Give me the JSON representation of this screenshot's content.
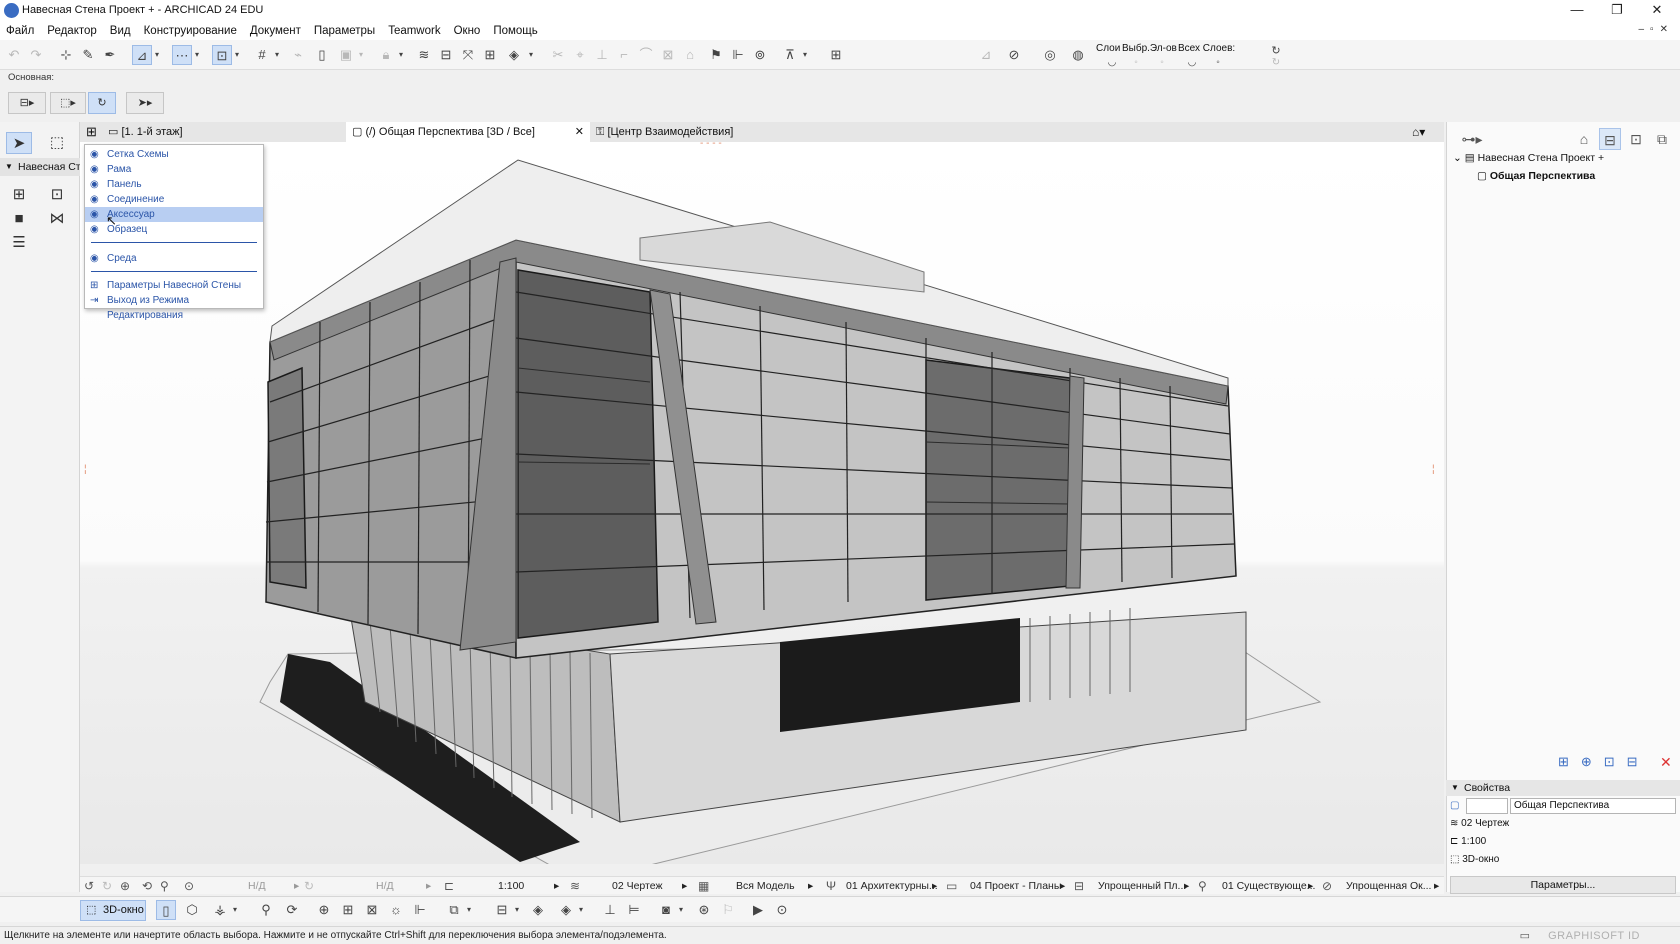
{
  "window": {
    "title": "Навесная Стена Проект + - ARCHICAD 24 EDU",
    "controls": [
      "—",
      "❐",
      "✕"
    ]
  },
  "menu": [
    "Файл",
    "Редактор",
    "Вид",
    "Конструирование",
    "Документ",
    "Параметры",
    "Teamwork",
    "Окно",
    "Помощь"
  ],
  "toolbar": {
    "layers_label": "Слои",
    "selected_elements_label": "Выбр.Эл-ов",
    "all_layers_label": "Всех Слоев:"
  },
  "basic_label": "Основная:",
  "tabs": [
    {
      "label": "[1. 1-й этаж]"
    },
    {
      "label": "(/) Общая Перспектива [3D / Все]"
    },
    {
      "label": "[Центр Взаимодействия]"
    }
  ],
  "toolbox": {
    "group": "Навесная Стена"
  },
  "context_menu": {
    "items": [
      {
        "label": "Сетка Схемы",
        "icon": "eye-icon"
      },
      {
        "label": "Рама",
        "icon": "eye-icon"
      },
      {
        "label": "Панель",
        "icon": "eye-icon"
      },
      {
        "label": "Соединение",
        "icon": "eye-icon"
      },
      {
        "label": "Аксессуар",
        "icon": "eye-icon",
        "highlighted": true
      },
      {
        "label": "Образец",
        "icon": "eye-icon"
      },
      {
        "label": "Среда",
        "icon": "eye-icon"
      },
      {
        "label": "Параметры Навесной Стены",
        "icon": "settings-icon"
      },
      {
        "label": "Выход из Режима Редактирования",
        "icon": "exit-icon"
      }
    ]
  },
  "nav_bar": {
    "zoom1": "Н/Д",
    "zoom2": "Н/Д",
    "scale": "1:100",
    "layer_combo": "02 Чертеж",
    "model": "Вся Модель",
    "pen_set": "01 Архитектурны...",
    "model_view": "04 Проект - Планы",
    "override": "Упрощенный Пл...",
    "renovation": "01 Существующе...",
    "structure": "Упрощенная Ок..."
  },
  "bottom_bar": {
    "view3d_label": "3D-окно"
  },
  "status_bar": {
    "text": "Щелкните на элементе или начертите область выбора. Нажмите и не отпускайте Ctrl+Shift для переключения выбора элемента/подэлемента.",
    "brand": "GRAPHISOFT ID"
  },
  "navigator": {
    "project": "Навесная Стена Проект +",
    "view": "Общая Перспектива"
  },
  "properties": {
    "header": "Свойства",
    "id_value": "",
    "name_value": "Общая Перспектива",
    "layer_combo": "02 Чертеж",
    "scale": "1:100",
    "window_type": "3D-окно",
    "settings_button": "Параметры..."
  },
  "colors": {
    "accent": "#2b55a8",
    "highlight": "#b8cef2",
    "selected_tool": "#cfe0f7"
  }
}
